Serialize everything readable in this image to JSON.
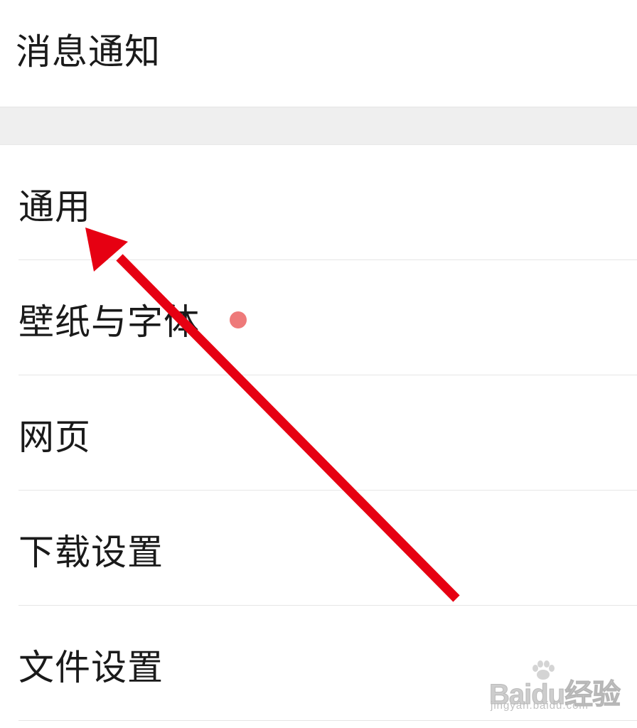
{
  "settings": {
    "top_item": {
      "label": "消息通知"
    },
    "items": [
      {
        "label": "通用"
      },
      {
        "label": "壁纸与字体",
        "has_badge_dot": true
      },
      {
        "label": "网页"
      },
      {
        "label": "下载设置"
      },
      {
        "label": "文件设置"
      }
    ]
  },
  "overlay": {
    "arrow_color": "#e60012"
  },
  "watermark": {
    "logo_text": "Baidu经验",
    "url": "jingyan.baidu.com"
  },
  "colors": {
    "background": "#ffffff",
    "section_gap": "#efefef",
    "divider": "#e6e6e6",
    "text": "#1a1a1a",
    "badge_dot": "#ee7a7a"
  }
}
